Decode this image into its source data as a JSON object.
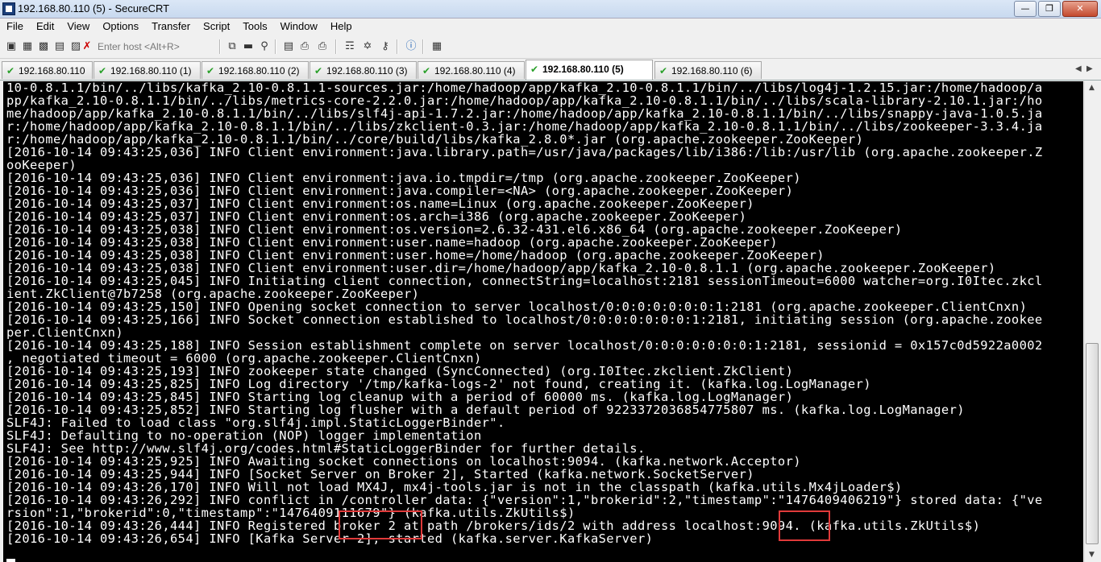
{
  "window": {
    "title": "192.168.80.110 (5) - SecureCRT"
  },
  "menu": [
    "File",
    "Edit",
    "View",
    "Options",
    "Transfer",
    "Script",
    "Tools",
    "Window",
    "Help"
  ],
  "toolbar": {
    "host_placeholder": "Enter host <Alt+R>"
  },
  "tabs": [
    {
      "label": "192.168.80.110",
      "active": false
    },
    {
      "label": "192.168.80.110 (1)",
      "active": false
    },
    {
      "label": "192.168.80.110 (2)",
      "active": false
    },
    {
      "label": "192.168.80.110 (3)",
      "active": false
    },
    {
      "label": "192.168.80.110 (4)",
      "active": false
    },
    {
      "label": "192.168.80.110 (5)",
      "active": true
    },
    {
      "label": "192.168.80.110 (6)",
      "active": false
    }
  ],
  "terminal": {
    "lines": [
      "10-0.8.1.1/bin/../libs/kafka_2.10-0.8.1.1-sources.jar:/home/hadoop/app/kafka_2.10-0.8.1.1/bin/../libs/log4j-1.2.15.jar:/home/hadoop/a",
      "pp/kafka_2.10-0.8.1.1/bin/../libs/metrics-core-2.2.0.jar:/home/hadoop/app/kafka_2.10-0.8.1.1/bin/../libs/scala-library-2.10.1.jar:/ho",
      "me/hadoop/app/kafka_2.10-0.8.1.1/bin/../libs/slf4j-api-1.7.2.jar:/home/hadoop/app/kafka_2.10-0.8.1.1/bin/../libs/snappy-java-1.0.5.ja",
      "r:/home/hadoop/app/kafka_2.10-0.8.1.1/bin/../libs/zkclient-0.3.jar:/home/hadoop/app/kafka_2.10-0.8.1.1/bin/../libs/zookeeper-3.3.4.ja",
      "r:/home/hadoop/app/kafka_2.10-0.8.1.1/bin/../core/build/libs/kafka_2.8.0*.jar (org.apache.zookeeper.ZooKeeper)",
      "[2016-10-14 09:43:25,036] INFO Client environment:java.library.path=/usr/java/packages/lib/i386:/lib:/usr/lib (org.apache.zookeeper.Z",
      "ooKeeper)",
      "[2016-10-14 09:43:25,036] INFO Client environment:java.io.tmpdir=/tmp (org.apache.zookeeper.ZooKeeper)",
      "[2016-10-14 09:43:25,036] INFO Client environment:java.compiler=<NA> (org.apache.zookeeper.ZooKeeper)",
      "[2016-10-14 09:43:25,037] INFO Client environment:os.name=Linux (org.apache.zookeeper.ZooKeeper)",
      "[2016-10-14 09:43:25,037] INFO Client environment:os.arch=i386 (org.apache.zookeeper.ZooKeeper)",
      "[2016-10-14 09:43:25,038] INFO Client environment:os.version=2.6.32-431.el6.x86_64 (org.apache.zookeeper.ZooKeeper)",
      "[2016-10-14 09:43:25,038] INFO Client environment:user.name=hadoop (org.apache.zookeeper.ZooKeeper)",
      "[2016-10-14 09:43:25,038] INFO Client environment:user.home=/home/hadoop (org.apache.zookeeper.ZooKeeper)",
      "[2016-10-14 09:43:25,038] INFO Client environment:user.dir=/home/hadoop/app/kafka_2.10-0.8.1.1 (org.apache.zookeeper.ZooKeeper)",
      "[2016-10-14 09:43:25,045] INFO Initiating client connection, connectString=localhost:2181 sessionTimeout=6000 watcher=org.I0Itec.zkcl",
      "ient.ZkClient@7b7258 (org.apache.zookeeper.ZooKeeper)",
      "[2016-10-14 09:43:25,150] INFO Opening socket connection to server localhost/0:0:0:0:0:0:0:1:2181 (org.apache.zookeeper.ClientCnxn)",
      "[2016-10-14 09:43:25,166] INFO Socket connection established to localhost/0:0:0:0:0:0:0:1:2181, initiating session (org.apache.zookee",
      "per.ClientCnxn)",
      "[2016-10-14 09:43:25,188] INFO Session establishment complete on server localhost/0:0:0:0:0:0:0:1:2181, sessionid = 0x157c0d5922a0002",
      ", negotiated timeout = 6000 (org.apache.zookeeper.ClientCnxn)",
      "[2016-10-14 09:43:25,193] INFO zookeeper state changed (SyncConnected) (org.I0Itec.zkclient.ZkClient)",
      "[2016-10-14 09:43:25,825] INFO Log directory '/tmp/kafka-logs-2' not found, creating it. (kafka.log.LogManager)",
      "[2016-10-14 09:43:25,845] INFO Starting log cleanup with a period of 60000 ms. (kafka.log.LogManager)",
      "[2016-10-14 09:43:25,852] INFO Starting log flusher with a default period of 9223372036854775807 ms. (kafka.log.LogManager)",
      "SLF4J: Failed to load class \"org.slf4j.impl.StaticLoggerBinder\".",
      "SLF4J: Defaulting to no-operation (NOP) logger implementation",
      "SLF4J: See http://www.slf4j.org/codes.html#StaticLoggerBinder for further details.",
      "[2016-10-14 09:43:25,925] INFO Awaiting socket connections on localhost:9094. (kafka.network.Acceptor)",
      "[2016-10-14 09:43:25,944] INFO [Socket Server on Broker 2], Started (kafka.network.SocketServer)",
      "[2016-10-14 09:43:26,170] INFO Will not load MX4J, mx4j-tools.jar is not in the classpath (kafka.utils.Mx4jLoader$)",
      "[2016-10-14 09:43:26,292] INFO conflict in /controller data: {\"version\":1,\"brokerid\":2,\"timestamp\":\"1476409406219\"} stored data: {\"ve",
      "rsion\":1,\"brokerid\":0,\"timestamp\":\"1476409111679\"} (kafka.utils.ZkUtils$)",
      "[2016-10-14 09:43:26,444] INFO Registered broker 2 at path /brokers/ids/2 with address localhost:9094. (kafka.utils.ZkUtils$)",
      "[2016-10-14 09:43:26,654] INFO [Kafka Server 2], started (kafka.server.KafkaServer)"
    ]
  },
  "colors": {
    "terminal_bg": "#000000",
    "terminal_fg": "#ffffff",
    "highlight": "#e03a3a",
    "tab_check": "#2aa02a"
  }
}
